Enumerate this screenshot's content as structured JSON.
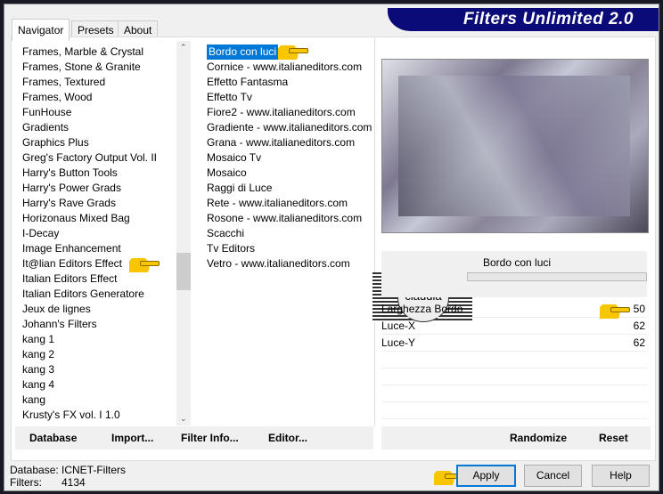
{
  "app": {
    "title": "Filters Unlimited 2.0"
  },
  "tabs": [
    {
      "label": "Navigator"
    },
    {
      "label": "Presets"
    },
    {
      "label": "About"
    }
  ],
  "categories": [
    "Frames, Marble & Crystal",
    "Frames, Stone & Granite",
    "Frames, Textured",
    "Frames, Wood",
    "FunHouse",
    "Gradients",
    "Graphics Plus",
    "Greg's Factory Output Vol. II",
    "Harry's Button Tools",
    "Harry's Power Grads",
    "Harry's Rave Grads",
    "Horizonaus Mixed Bag",
    "I-Decay",
    "Image Enhancement",
    "It@lian Editors Effect",
    "Italian Editors Effect",
    "Italian Editors Generatore",
    "Jeux de lignes",
    "Johann's Filters",
    "kang 1",
    "kang 2",
    "kang 3",
    "kang 4",
    "kang",
    "Krusty's FX vol. I 1.0"
  ],
  "filters": [
    "Bordo con luci",
    "Cornice - www.italianeditors.com",
    "Effetto Fantasma",
    "Effetto Tv",
    "Fiore2 - www.italianeditors.com",
    "Gradiente - www.italianeditors.com",
    "Grana - www.italianeditors.com",
    "Mosaico Tv",
    "Mosaico",
    "Raggi di Luce",
    "Rete - www.italianeditors.com",
    "Rosone - www.italianeditors.com",
    "Scacchi",
    "Tv Editors",
    "Vetro - www.italianeditors.com"
  ],
  "selected_filter": "Bordo con luci",
  "watermark": "claudia",
  "params": [
    {
      "label": "Larghezza Bordo",
      "value": "50"
    },
    {
      "label": "Luce-X",
      "value": "62"
    },
    {
      "label": "Luce-Y",
      "value": "62"
    }
  ],
  "left_buttons": {
    "database": "Database",
    "import": "Import...",
    "filter_info": "Filter Info...",
    "editor": "Editor..."
  },
  "right_buttons": {
    "randomize": "Randomize",
    "reset": "Reset"
  },
  "status": {
    "db_label": "Database:",
    "db_value": "ICNET-Filters",
    "filters_label": "Filters:",
    "filters_value": "4134"
  },
  "dialog": {
    "apply": "Apply",
    "cancel": "Cancel",
    "help": "Help"
  }
}
